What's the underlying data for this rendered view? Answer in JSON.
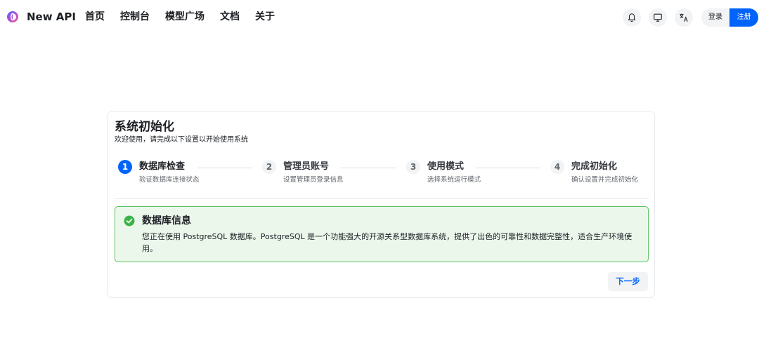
{
  "header": {
    "brand": "New API",
    "nav": [
      "首页",
      "控制台",
      "模型广场",
      "文档",
      "关于"
    ],
    "icons": [
      "bell-icon",
      "monitor-icon",
      "translate-icon"
    ],
    "login_label": "登录",
    "register_label": "注册",
    "accent_color": "#0064fa"
  },
  "setup": {
    "title": "系统初始化",
    "subtitle": "欢迎使用，请完成以下设置以开始使用系统",
    "steps": [
      {
        "number": "1",
        "title": "数据库检查",
        "desc": "验证数据库连接状态",
        "active": true
      },
      {
        "number": "2",
        "title": "管理员账号",
        "desc": "设置管理员登录信息",
        "active": false
      },
      {
        "number": "3",
        "title": "使用模式",
        "desc": "选择系统运行模式",
        "active": false
      },
      {
        "number": "4",
        "title": "完成初始化",
        "desc": "确认设置并完成初始化",
        "active": false
      }
    ],
    "alert": {
      "icon": "check-circle-icon",
      "title": "数据库信息",
      "text": "您正在使用 PostgreSQL 数据库。PostgreSQL 是一个功能强大的开源关系型数据库系统，提供了出色的可靠性和数据完整性，适合生产环境使用。",
      "color": "#5ac262"
    },
    "next_label": "下一步"
  }
}
